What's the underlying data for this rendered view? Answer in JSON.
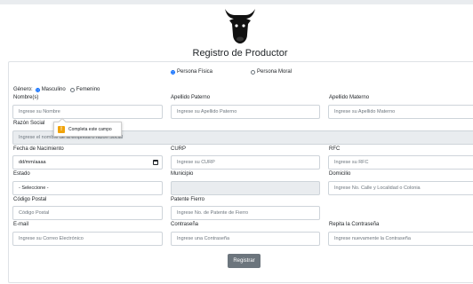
{
  "header": {
    "title": "Registro de Productor"
  },
  "tipo_persona": {
    "options": [
      "Persona Física",
      "Persona Moral"
    ],
    "selected": "Persona Física"
  },
  "genero": {
    "label": "Género:",
    "options": [
      "Masculino",
      "Femenino"
    ],
    "selected": "Masculino"
  },
  "fields": {
    "nombre": {
      "label": "Nombre(s)",
      "placeholder": "Ingrese su Nombre"
    },
    "apellido_paterno": {
      "label": "Apellido Paterno",
      "placeholder": "Ingrese su Apellido Paterno"
    },
    "apellido_materno": {
      "label": "Apellido Materno",
      "placeholder": "Ingrese su Apellido Materno"
    },
    "razon_social": {
      "label": "Razón Social",
      "placeholder": "Ingrese el nombre de la empresa o razón Social"
    },
    "fecha_nacimiento": {
      "label": "Fecha de Nacimiento",
      "value": "dd/mm/aaaa"
    },
    "curp": {
      "label": "CURP",
      "placeholder": "Ingrese su CURP"
    },
    "rfc": {
      "label": "RFC",
      "placeholder": "Ingrese su RFC"
    },
    "estado": {
      "label": "Estado",
      "value": "- Seleccione -"
    },
    "municipio": {
      "label": "Municipio",
      "value": ""
    },
    "domicilio": {
      "label": "Domicilio",
      "placeholder": "Ingrese No. Calle y Localidad o Colonia"
    },
    "codigo_postal": {
      "label": "Código Postal",
      "placeholder": "Código Postal"
    },
    "patente_fierro": {
      "label": "Patente Fierro",
      "placeholder": "Ingrese No. de Patente de Fierro"
    },
    "email": {
      "label": "E-mail",
      "placeholder": "Ingrese su Correo Electrónico"
    },
    "contrasena": {
      "label": "Contraseña",
      "placeholder": "Ingrese una Contraseña"
    },
    "repita_contrasena": {
      "label": "Repita la Contraseña",
      "placeholder": "Ingrese nuevamente la Contraseña"
    }
  },
  "tooltip": {
    "icon": "warning-icon",
    "text": "Completa este campo"
  },
  "submit": {
    "label": "Registrar"
  },
  "colors": {
    "accent": "#0d6efd",
    "button": "#6c757d",
    "warning": "#f0a30a"
  },
  "logo": {
    "icon": "bull-head-icon"
  }
}
